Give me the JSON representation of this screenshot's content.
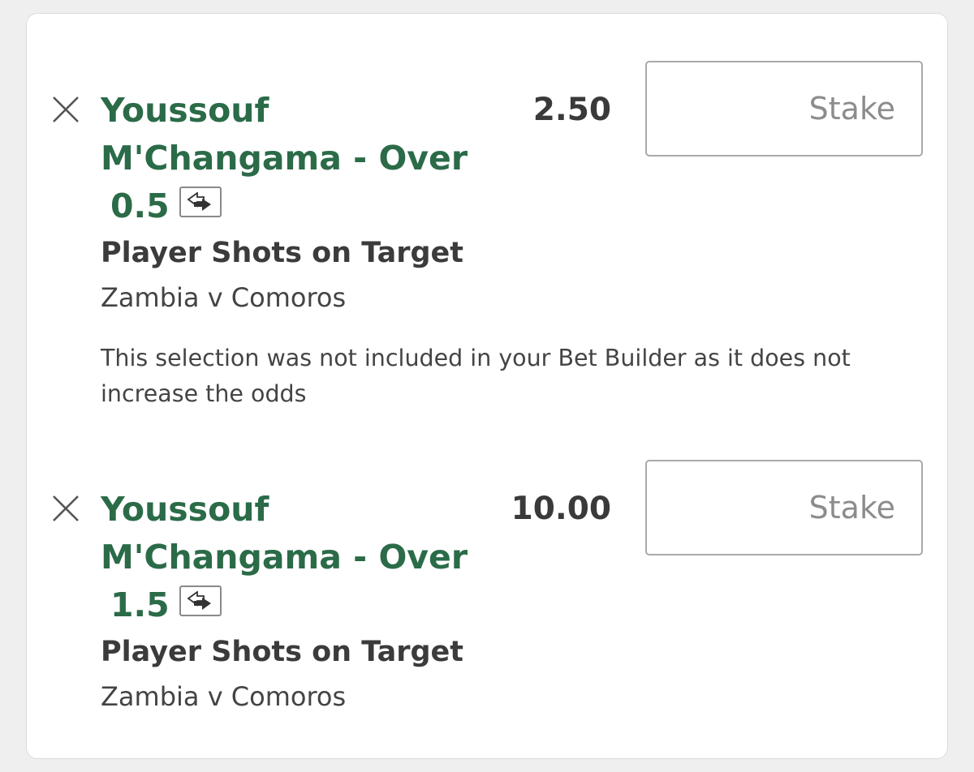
{
  "bets": [
    {
      "selection_line1": "Youssouf",
      "selection_line2": "M'Changama - Over",
      "line_value": "0.5",
      "odds": "2.50",
      "stake_placeholder": "Stake",
      "market": "Player Shots on Target",
      "event": "Zambia v Comoros",
      "note": "This selection was not included in your Bet Builder as it does not increase the odds"
    },
    {
      "selection_line1": "Youssouf",
      "selection_line2": "M'Changama - Over",
      "line_value": "1.5",
      "odds": "10.00",
      "stake_placeholder": "Stake",
      "market": "Player Shots on Target",
      "event": "Zambia v Comoros"
    }
  ],
  "icons": {
    "remove": "close-icon",
    "swap": "swap-arrows-icon"
  },
  "colors": {
    "selection_green": "#2b6b48",
    "background": "#efefef"
  }
}
